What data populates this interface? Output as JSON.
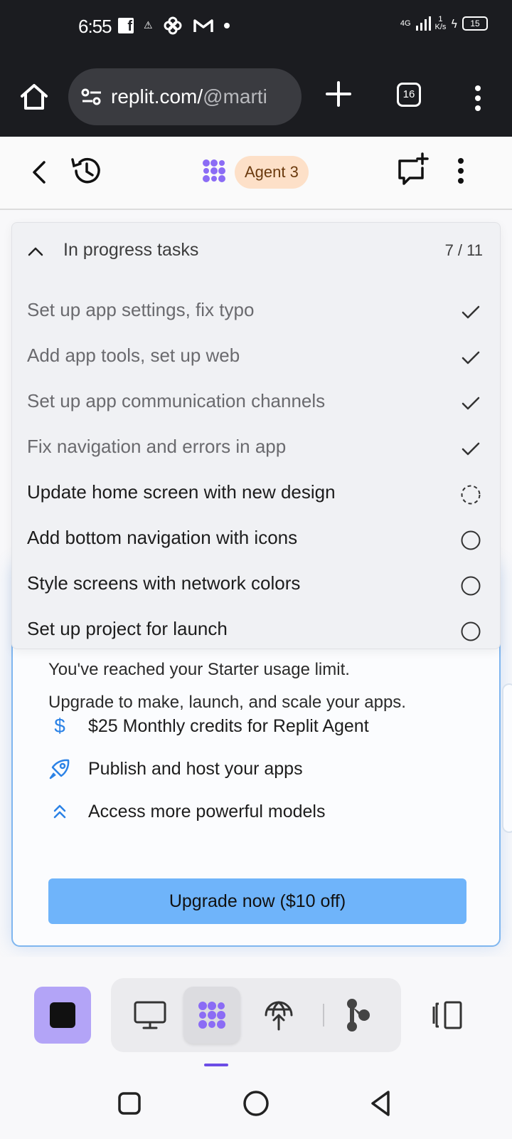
{
  "status_bar": {
    "time": "6:55",
    "network_label": "4G",
    "speed_value": "1",
    "speed_unit": "K/s",
    "battery": "15"
  },
  "browser": {
    "url_main": "replit.com/",
    "url_faded": "@marti",
    "tab_count": "16"
  },
  "app_header": {
    "agent_badge": "Agent 3"
  },
  "tasks": {
    "title": "In progress tasks",
    "count": "7 / 11",
    "items": [
      {
        "label": "Set up app settings, fix typo",
        "status": "done"
      },
      {
        "label": "Add app tools, set up web",
        "status": "done"
      },
      {
        "label": "Set up app communication channels",
        "status": "done"
      },
      {
        "label": "Fix navigation and errors in app",
        "status": "done"
      },
      {
        "label": "Update home screen with new design",
        "status": "in-progress"
      },
      {
        "label": "Add bottom navigation with icons",
        "status": "pending"
      },
      {
        "label": "Style screens with network colors",
        "status": "pending"
      },
      {
        "label": "Set up project for launch",
        "status": "pending"
      }
    ]
  },
  "upgrade": {
    "line1": "You've reached your Starter usage limit.",
    "line2": "Upgrade to make, launch, and scale your apps.",
    "features": [
      {
        "icon": "dollar-icon",
        "label": "$25 Monthly credits for Replit Agent"
      },
      {
        "icon": "rocket-icon",
        "label": "Publish and host your apps"
      },
      {
        "icon": "double-chevron-up-icon",
        "label": "Access more powerful models"
      }
    ],
    "button_label": "Upgrade now ($10 off)",
    "accent_color": "#6fb4fa"
  },
  "toolbar": {
    "stop_color": "#b3a4f7",
    "selected_tool": "agent"
  },
  "colors": {
    "agent_purple": "#8b6cf5",
    "badge_bg": "#fde0c8",
    "dark_bar": "#1b1c20"
  }
}
